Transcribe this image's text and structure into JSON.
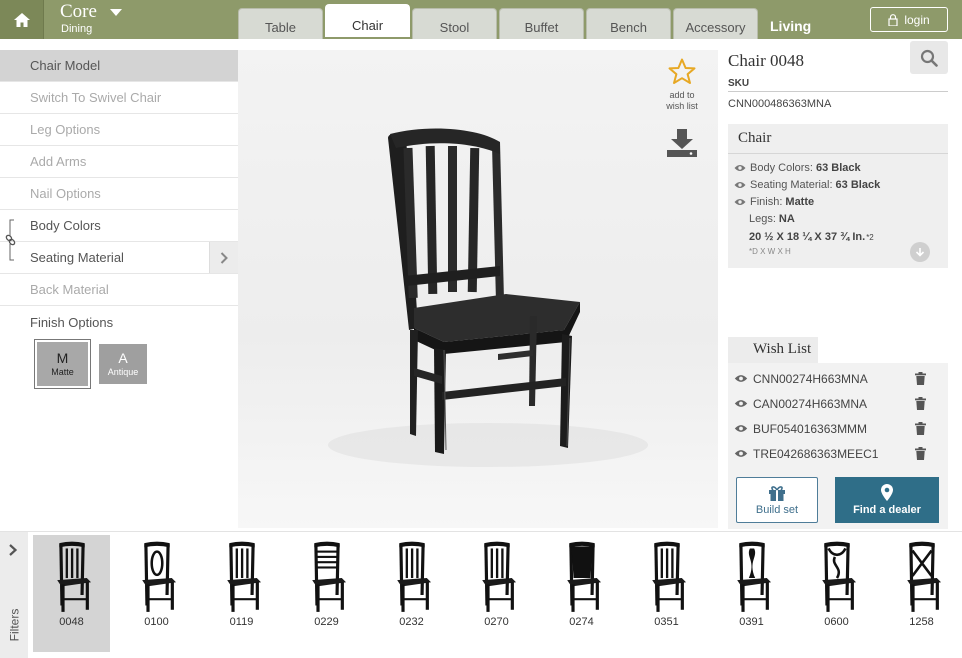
{
  "header": {
    "brand_title": "Core",
    "brand_subtitle": "Dining",
    "tabs": [
      "Table",
      "Chair",
      "Stool",
      "Buffet",
      "Bench",
      "Accessory"
    ],
    "active_tab": "Chair",
    "extra_tab": "Living",
    "login_label": "login"
  },
  "options": {
    "header": "Chair Model",
    "items": [
      "Switch To Swivel Chair",
      "Leg Options",
      "Add Arms",
      "Nail Options",
      "Body Colors",
      "Seating Material",
      "Back Material",
      "Finish Options"
    ],
    "finishes": [
      {
        "code": "M",
        "name": "Matte"
      },
      {
        "code": "A",
        "name": "Antique"
      }
    ]
  },
  "viewer": {
    "wish_add_line1": "add to",
    "wish_add_line2": "wish list"
  },
  "product": {
    "title": "Chair 0048",
    "sku_label": "SKU",
    "sku": "CNN000486363MNA",
    "spec_title": "Chair",
    "specs": [
      {
        "label": "Body Colors:",
        "value": "63 Black"
      },
      {
        "label": "Seating Material:",
        "value": "63 Black"
      },
      {
        "label": "Finish:",
        "value": "Matte"
      }
    ],
    "legs_label": "Legs:",
    "legs_value": "NA",
    "dimensions": "20 ½ X 18 ¼ X 37 ¾ In.",
    "dimensions_note": "*2",
    "dimensions_legend": "*D X W X H"
  },
  "wishlist": {
    "title": "Wish List",
    "items": [
      "CNN00274H663MNA",
      "CAN00274H663MNA",
      "BUF054016363MMM",
      "TRE042686363MEEC1"
    ]
  },
  "actions": {
    "build_set": "Build set",
    "find_dealer": "Find a dealer"
  },
  "filters_label": "Filters",
  "thumbnails": [
    "0048",
    "0100",
    "0119",
    "0229",
    "0232",
    "0270",
    "0274",
    "0351",
    "0391",
    "0600",
    "1258"
  ],
  "colors": {
    "header_green": "#8e9a6a",
    "dealer_blue": "#2f6e88",
    "star_gold": "#e7a824"
  }
}
